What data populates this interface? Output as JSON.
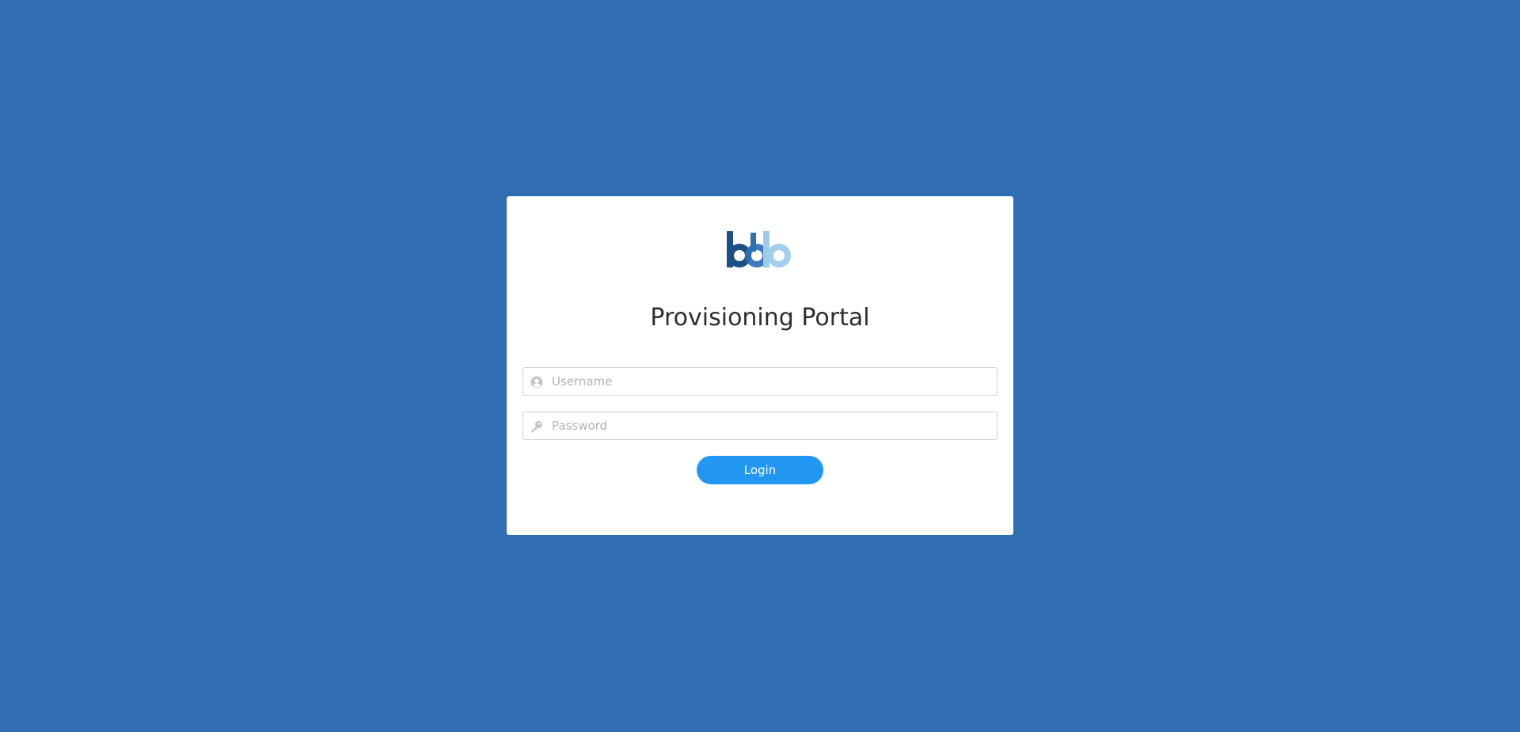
{
  "page": {
    "background_color": "#316db2"
  },
  "logo": {
    "brand_colors": [
      "#1b4f86",
      "#2f6fb6",
      "#9ccbea"
    ]
  },
  "login_form": {
    "title": "Provisioning Portal",
    "username": {
      "placeholder": "Username",
      "value": "",
      "icon": "user-circle-icon"
    },
    "password": {
      "placeholder": "Password",
      "value": "",
      "icon": "key-icon"
    },
    "submit_label": "Login",
    "submit_color": "#2196f3"
  }
}
